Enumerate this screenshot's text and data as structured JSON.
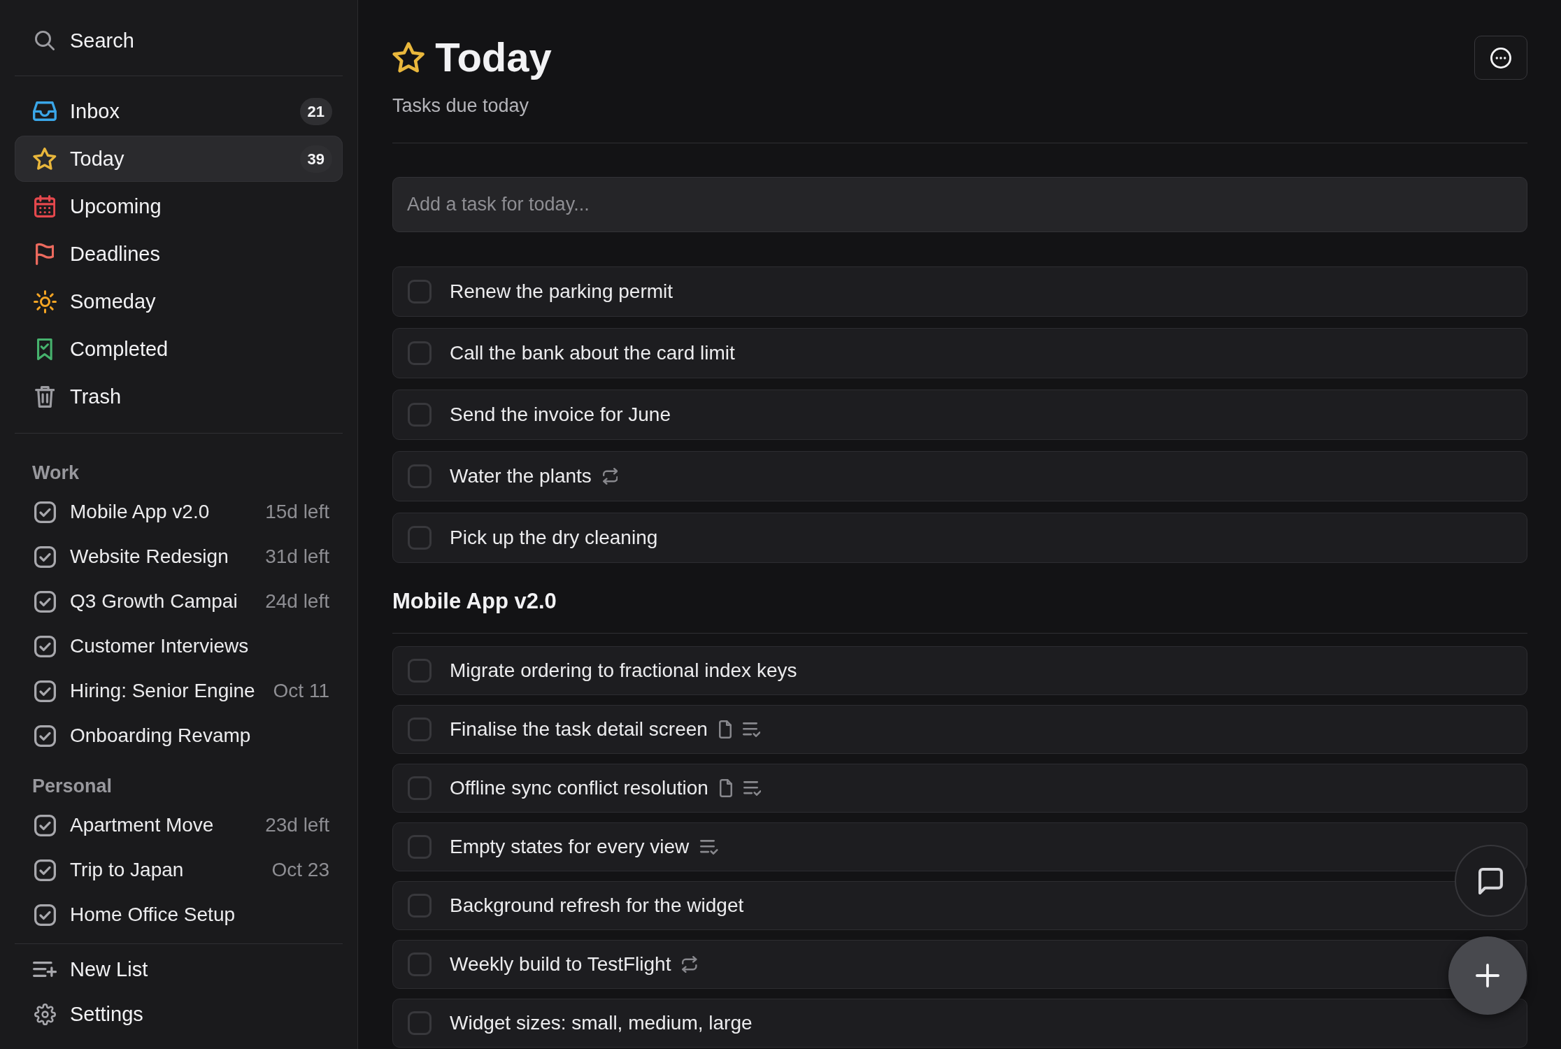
{
  "sidebar": {
    "search": {
      "label": "Search"
    },
    "nav": [
      {
        "kind": "inbox",
        "label": "Inbox",
        "count": "21",
        "selected": false
      },
      {
        "kind": "today",
        "label": "Today",
        "count": "39",
        "selected": true
      },
      {
        "kind": "upcoming",
        "label": "Upcoming",
        "selected": false
      },
      {
        "kind": "deadlines",
        "label": "Deadlines",
        "selected": false
      },
      {
        "kind": "someday",
        "label": "Someday",
        "selected": false
      },
      {
        "kind": "completed",
        "label": "Completed",
        "selected": false
      },
      {
        "kind": "trash",
        "label": "Trash",
        "selected": false
      }
    ],
    "sections": [
      {
        "title": "Work",
        "projects": [
          {
            "name": "Mobile App v2.0",
            "due": "15d left",
            "selected": false
          },
          {
            "name": "Website Redesign",
            "due": "31d left",
            "selected": false
          },
          {
            "name": "Q3 Growth Campai",
            "due": "24d left",
            "selected": false
          },
          {
            "name": "Customer Interviews",
            "selected": false
          },
          {
            "name": "Hiring: Senior Engine",
            "due": "Oct 11",
            "selected": false
          },
          {
            "name": "Onboarding Revamp",
            "selected": false
          }
        ]
      },
      {
        "title": "Personal",
        "projects": [
          {
            "name": "Apartment Move",
            "due": "23d left",
            "selected": false
          },
          {
            "name": "Trip to Japan",
            "due": "Oct 23",
            "selected": false
          },
          {
            "name": "Home Office Setup",
            "selected": false
          }
        ]
      }
    ],
    "footer": [
      {
        "kind": "new_list",
        "label": "New List"
      },
      {
        "kind": "settings",
        "label": "Settings"
      }
    ]
  },
  "main": {
    "title": "Today",
    "subtitle": "Tasks due today",
    "add_task": {
      "placeholder": "Add a task for today..."
    },
    "tasks": [
      {
        "title": "Renew the parking permit",
        "checked": false,
        "has_notes": false,
        "has_checklist": false,
        "repeats": false
      },
      {
        "title": "Call the bank about the card limit",
        "checked": false,
        "has_notes": false,
        "has_checklist": false,
        "repeats": false
      },
      {
        "title": "Send the invoice for June",
        "checked": false,
        "has_notes": false,
        "has_checklist": false,
        "repeats": false
      },
      {
        "title": "Water the plants",
        "checked": false,
        "has_notes": false,
        "has_checklist": false,
        "repeats": true
      },
      {
        "title": "Pick up the dry cleaning",
        "checked": false,
        "has_notes": false,
        "has_checklist": false,
        "repeats": false
      }
    ],
    "sections": [
      {
        "title": "Mobile App v2.0",
        "tasks": [
          {
            "title": "Migrate ordering to fractional index keys",
            "checked": false,
            "has_notes": false,
            "has_checklist": false,
            "repeats": false
          },
          {
            "title": "Finalise the task detail screen",
            "checked": false,
            "has_notes": true,
            "has_checklist": true,
            "repeats": false
          },
          {
            "title": "Offline sync conflict resolution",
            "checked": false,
            "has_notes": true,
            "has_checklist": true,
            "repeats": false
          },
          {
            "title": "Empty states for every view",
            "checked": false,
            "has_notes": false,
            "has_checklist": true,
            "repeats": false
          },
          {
            "title": "Background refresh for the widget",
            "checked": false,
            "has_notes": false,
            "has_checklist": false,
            "repeats": false
          },
          {
            "title": "Weekly build to TestFlight",
            "checked": false,
            "has_notes": false,
            "has_checklist": false,
            "repeats": true
          },
          {
            "title": "Widget sizes: small, medium, large",
            "checked": false,
            "has_notes": false,
            "has_checklist": false,
            "repeats": false
          }
        ]
      }
    ]
  }
}
